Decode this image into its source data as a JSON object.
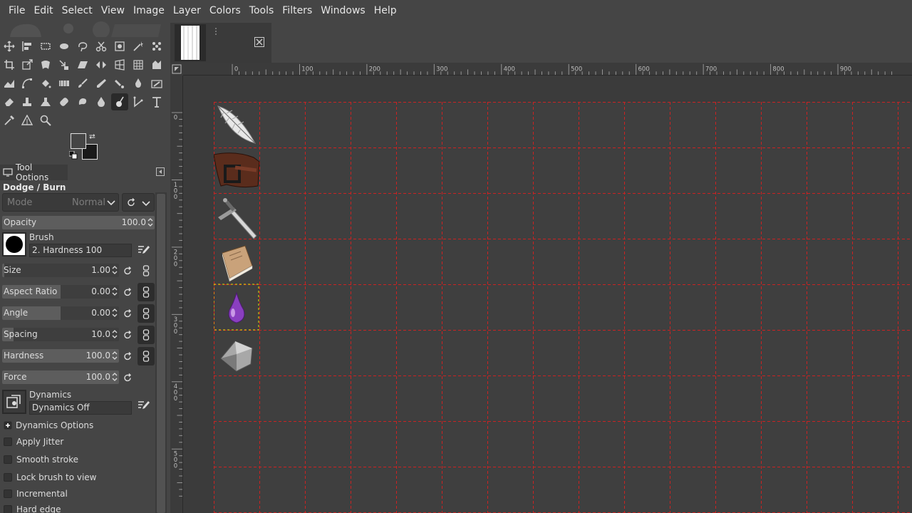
{
  "menu": [
    "File",
    "Edit",
    "Select",
    "View",
    "Image",
    "Layer",
    "Colors",
    "Tools",
    "Filters",
    "Windows",
    "Help"
  ],
  "tool_options": {
    "tab_label": "Tool Options",
    "tool_name": "Dodge / Burn",
    "mode_label": "Mode",
    "mode_value": "Normal",
    "opacity": {
      "label": "Opacity",
      "value": "100.0",
      "fraction": 1.0
    },
    "brush_label": "Brush",
    "brush_value": "2. Hardness 100",
    "size": {
      "label": "Size",
      "value": "1.00",
      "fraction": 0.02
    },
    "aspect_ratio": {
      "label": "Aspect Ratio",
      "value": "0.00",
      "fraction": 0.5
    },
    "angle": {
      "label": "Angle",
      "value": "0.00",
      "fraction": 0.5
    },
    "spacing": {
      "label": "Spacing",
      "value": "10.0",
      "fraction": 0.1
    },
    "hardness": {
      "label": "Hardness",
      "value": "100.0",
      "fraction": 1.0
    },
    "force": {
      "label": "Force",
      "value": "100.0",
      "fraction": 1.0
    },
    "dynamics_label": "Dynamics",
    "dynamics_value": "Dynamics Off",
    "dynamics_options": "Dynamics Options",
    "apply_jitter": "Apply Jitter",
    "smooth_stroke": "Smooth stroke",
    "lock_brush": "Lock brush to view",
    "incremental": "Incremental",
    "hard_edge": "Hard edge"
  },
  "ruler": {
    "h_labels": [
      "0",
      "100",
      "200",
      "300",
      "400",
      "500",
      "600",
      "700",
      "800",
      "900"
    ],
    "v_labels": [
      "0",
      "100",
      "200",
      "300",
      "400",
      "500"
    ]
  },
  "canvas_items": [
    "feather",
    "leather belt",
    "sword",
    "book",
    "purple potion drop",
    "iron ingot"
  ],
  "colors": {
    "grid": "#cc2222",
    "selection": "#e8e000",
    "panel": "#454545",
    "canvas": "#3b3b3b"
  }
}
